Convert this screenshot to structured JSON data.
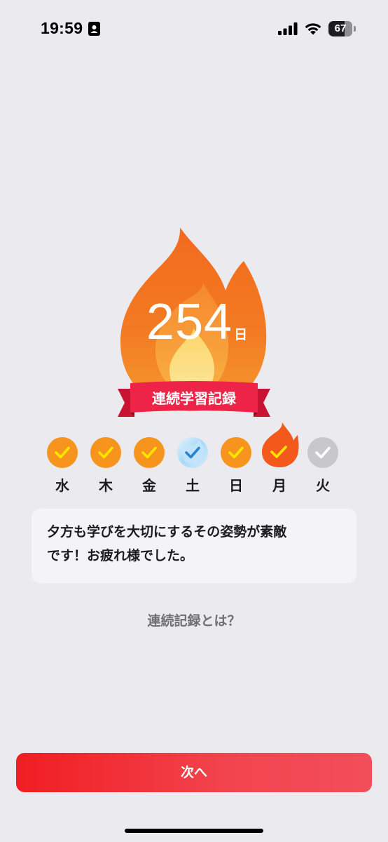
{
  "status_bar": {
    "time": "19:59",
    "contact_icon": "contact-card-icon",
    "signal_icon": "cellular-signal-icon",
    "wifi_icon": "wifi-icon",
    "battery_level": "67",
    "battery_fraction": 0.67
  },
  "streak": {
    "count": "254",
    "unit": "日",
    "banner_label": "連続学習記録",
    "flame_icon": "flame-icon"
  },
  "week": [
    {
      "label": "水",
      "state": "done",
      "icon": "check-circle-icon"
    },
    {
      "label": "木",
      "state": "done",
      "icon": "check-circle-icon"
    },
    {
      "label": "金",
      "state": "done",
      "icon": "check-circle-icon"
    },
    {
      "label": "土",
      "state": "freeze",
      "icon": "ice-check-icon"
    },
    {
      "label": "日",
      "state": "done",
      "icon": "check-circle-icon"
    },
    {
      "label": "月",
      "state": "today",
      "icon": "flame-check-icon"
    },
    {
      "label": "火",
      "state": "pending",
      "icon": "check-circle-icon"
    }
  ],
  "message": {
    "line1": "夕方も学びを大切にするその姿勢が素敵",
    "line2": "です！お疲れ様でした。"
  },
  "about_link": "連続記録とは？",
  "next_button": "次へ",
  "colors": {
    "background": "#ebeaef",
    "accent_red": "#f01e22",
    "flame_orange": "#f36a20",
    "done_orange": "#f7941d",
    "check_yellow": "#ffe600",
    "pending_gray": "#c8c7cc"
  }
}
